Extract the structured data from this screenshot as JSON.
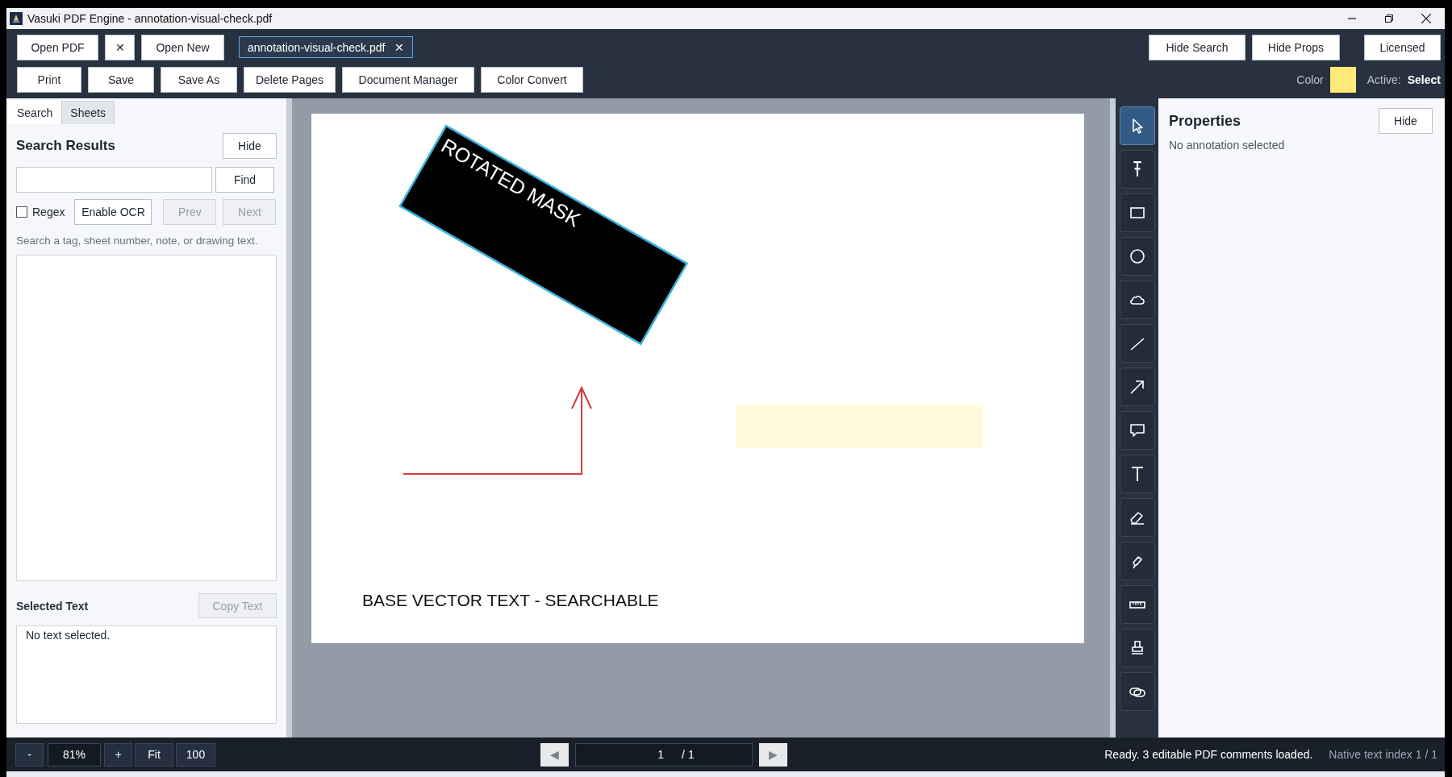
{
  "window": {
    "title": "Vasuki PDF Engine - annotation-visual-check.pdf"
  },
  "toolbar": {
    "file_buttons": [
      {
        "label": "Open PDF"
      },
      {
        "label": "✕"
      },
      {
        "label": "Open New"
      }
    ],
    "document_tabs": [
      {
        "label": "annotation-visual-check.pdf",
        "close": "✕",
        "selected": true
      }
    ],
    "action_buttons": [
      {
        "label": "Print"
      },
      {
        "label": "Save"
      },
      {
        "label": "Save As"
      },
      {
        "label": "Delete Pages"
      },
      {
        "label": "Document Manager"
      },
      {
        "label": "Color Convert"
      }
    ],
    "view_buttons": [
      {
        "label": "Hide Search"
      },
      {
        "label": "Hide Props"
      }
    ],
    "license_button": "Licensed",
    "color_label": "Color",
    "color": "#fdea7b",
    "active_label": "Active:",
    "active_tool": "Select"
  },
  "search_panel": {
    "tabs": [
      {
        "label": "Search",
        "selected": true
      },
      {
        "label": "Sheets",
        "selected": false
      }
    ],
    "title": "Search Results",
    "hide_button": "Hide",
    "find_button": "Find",
    "regex": {
      "label": "Regex",
      "checked": false
    },
    "ocr_button": "Enable OCR",
    "nav_buttons": [
      {
        "label": "Prev",
        "disabled": true
      },
      {
        "label": "Next",
        "disabled": true
      }
    ],
    "hint": "Search a tag, sheet number, note, or drawing text.",
    "selected_text": {
      "title": "Selected Text",
      "copy_button": {
        "label": "Copy Text",
        "disabled": true
      },
      "content": "No text selected."
    }
  },
  "document": {
    "page_text": "BASE VECTOR TEXT - SEARCHABLE",
    "annotations": [
      {
        "kind": "mask",
        "label": "ROTATED MASK"
      },
      {
        "kind": "arrow"
      },
      {
        "kind": "highlight"
      }
    ]
  },
  "tools": [
    {
      "kind": "select",
      "selected": true
    },
    {
      "kind": "text-select",
      "selected": false
    },
    {
      "kind": "rectangle",
      "selected": false
    },
    {
      "kind": "ellipse",
      "selected": false
    },
    {
      "kind": "cloud",
      "selected": false
    },
    {
      "kind": "line",
      "selected": false
    },
    {
      "kind": "arrow",
      "selected": false
    },
    {
      "kind": "callout",
      "selected": false
    },
    {
      "kind": "text",
      "selected": false
    },
    {
      "kind": "eraser",
      "selected": false
    },
    {
      "kind": "highlighter",
      "selected": false
    },
    {
      "kind": "measure",
      "selected": false
    },
    {
      "kind": "stamp",
      "selected": false
    },
    {
      "kind": "link",
      "selected": false
    }
  ],
  "properties": {
    "title": "Properties",
    "hide_button": "Hide",
    "message": "No annotation selected"
  },
  "status_bar": {
    "zoom_out": "-",
    "zoom": "81%",
    "zoom_in": "+",
    "fit": "Fit",
    "actual": "100",
    "prev": "◀",
    "page": "1",
    "page_count": "/ 1",
    "next": "▶",
    "message": "Ready. 3 editable PDF comments loaded.",
    "index": "Native text index 1 / 1"
  }
}
